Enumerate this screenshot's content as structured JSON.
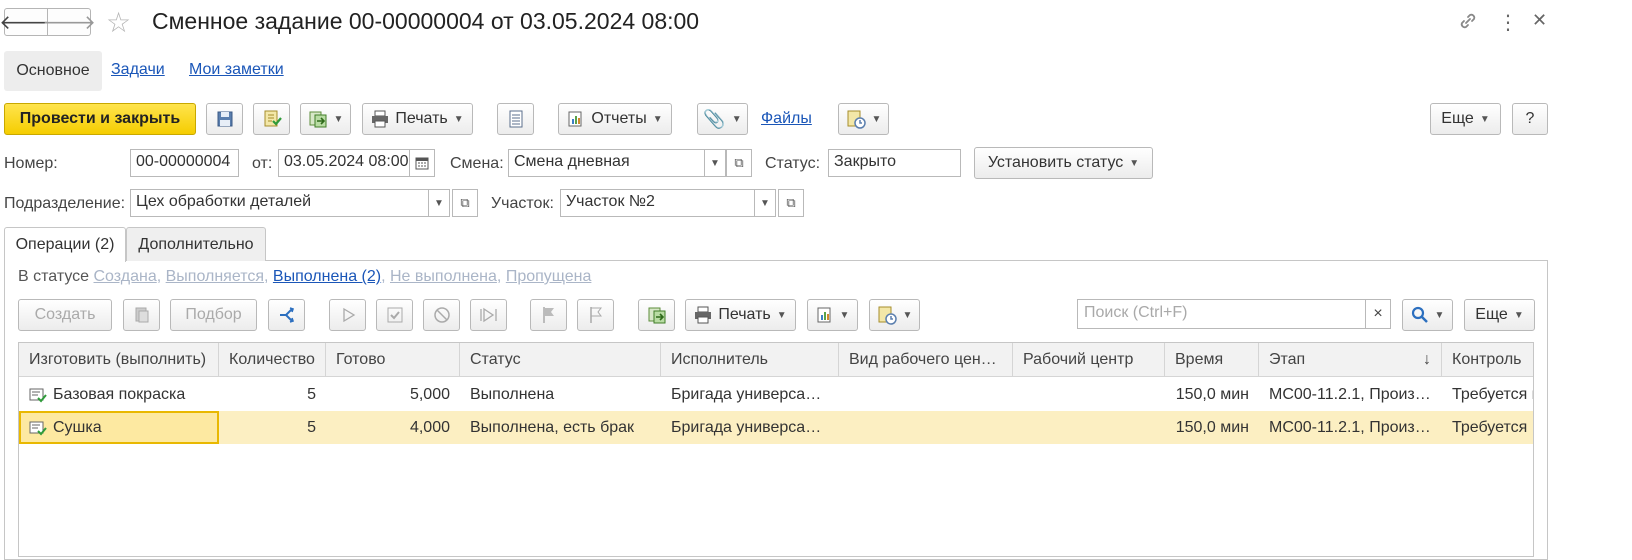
{
  "header": {
    "back_icon": "arrow-left-icon",
    "forward_icon": "arrow-right-icon",
    "star_icon": "star-icon",
    "title": "Сменное задание 00-00000004 от 03.05.2024 08:00"
  },
  "topnav": {
    "main": "Основное",
    "tasks": "Задачи",
    "notes": "Мои заметки"
  },
  "toolbar": {
    "post_close": "Провести и закрыть",
    "print": "Печать",
    "reports": "Отчеты",
    "files": "Файлы",
    "more": "Еще",
    "help": "?"
  },
  "form": {
    "number_label": "Номер:",
    "number_value": "00-00000004",
    "from_label": "от:",
    "date_value": "03.05.2024 08:00",
    "shift_label": "Смена:",
    "shift_value": "Смена дневная",
    "status_label": "Статус:",
    "status_value": "Закрыто",
    "set_status": "Установить статус",
    "division_label": "Подразделение:",
    "division_value": "Цех обработки деталей",
    "section_label": "Участок:",
    "section_value": "Участок №2"
  },
  "tabs": {
    "operations": "Операции (2)",
    "additional": "Дополнительно"
  },
  "status_filter": {
    "label": "В статусе",
    "created": "Создана",
    "in_progress": "Выполняется",
    "done": "Выполнена (2)",
    "not_done": "Не выполнена",
    "skipped": "Пропущена"
  },
  "table_toolbar": {
    "create": "Создать",
    "pick": "Подбор",
    "print": "Печать",
    "search_placeholder": "Поиск (Ctrl+F)",
    "clear": "×",
    "more": "Еще"
  },
  "table": {
    "columns": [
      "Изготовить (выполнить)",
      "Количество",
      "Готово",
      "Статус",
      "Исполнитель",
      "Вид рабочего цен…",
      "Рабочий центр",
      "Время",
      "Этап",
      "Контроль"
    ],
    "sort_indicator": "↓",
    "rows": [
      {
        "name": "Базовая покраска",
        "qty": "5",
        "ready": "5,000",
        "status": "Выполнена",
        "executor": "Бригада универса…",
        "wc_type": "",
        "wc": "",
        "time": "150,0 мин",
        "stage": "МС00-11.2.1, Произ…",
        "control": "Требуется к"
      },
      {
        "name": "Сушка",
        "qty": "5",
        "ready": "4,000",
        "status": "Выполнена, есть брак",
        "executor": "Бригада универса…",
        "wc_type": "",
        "wc": "",
        "time": "150,0 мин",
        "stage": "МС00-11.2.1, Произ…",
        "control": "Требуется"
      }
    ]
  },
  "colors": {
    "primary_button": "#f5cd00",
    "link": "#1a56b8",
    "selected_row": "#fcefc2",
    "focus_border": "#e9b800"
  }
}
